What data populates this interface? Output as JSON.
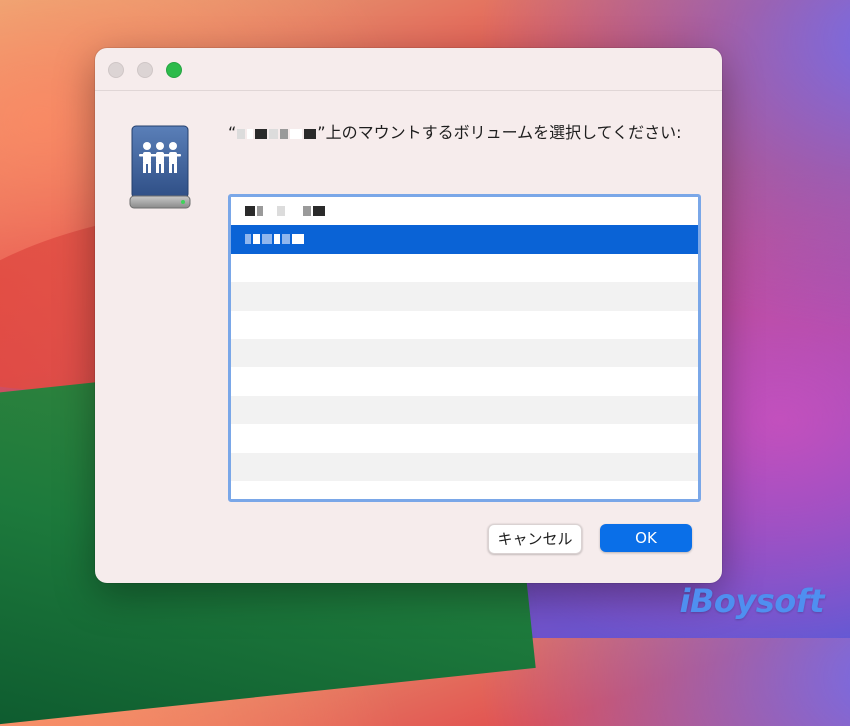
{
  "dialog": {
    "prompt_open_quote": "“",
    "prompt_close_quote": "”",
    "prompt_text": "上のマウントするボリュームを選択してください:",
    "icon": "network-share-drive-icon",
    "volumes": [
      {
        "label": "(redacted)",
        "selected": false
      },
      {
        "label": "(redacted)",
        "selected": true
      }
    ],
    "empty_rows": 8
  },
  "buttons": {
    "cancel_label": "キャンセル",
    "ok_label": "OK"
  },
  "window_controls": [
    "close-button",
    "minimize-button",
    "zoom-button"
  ],
  "watermark": "iBoysoft",
  "colors": {
    "selection": "#0a63d6",
    "ok_button": "#0a6fe8",
    "list_focus_ring": "#7aa7e8",
    "zoom_button": "#2dbb4b"
  }
}
